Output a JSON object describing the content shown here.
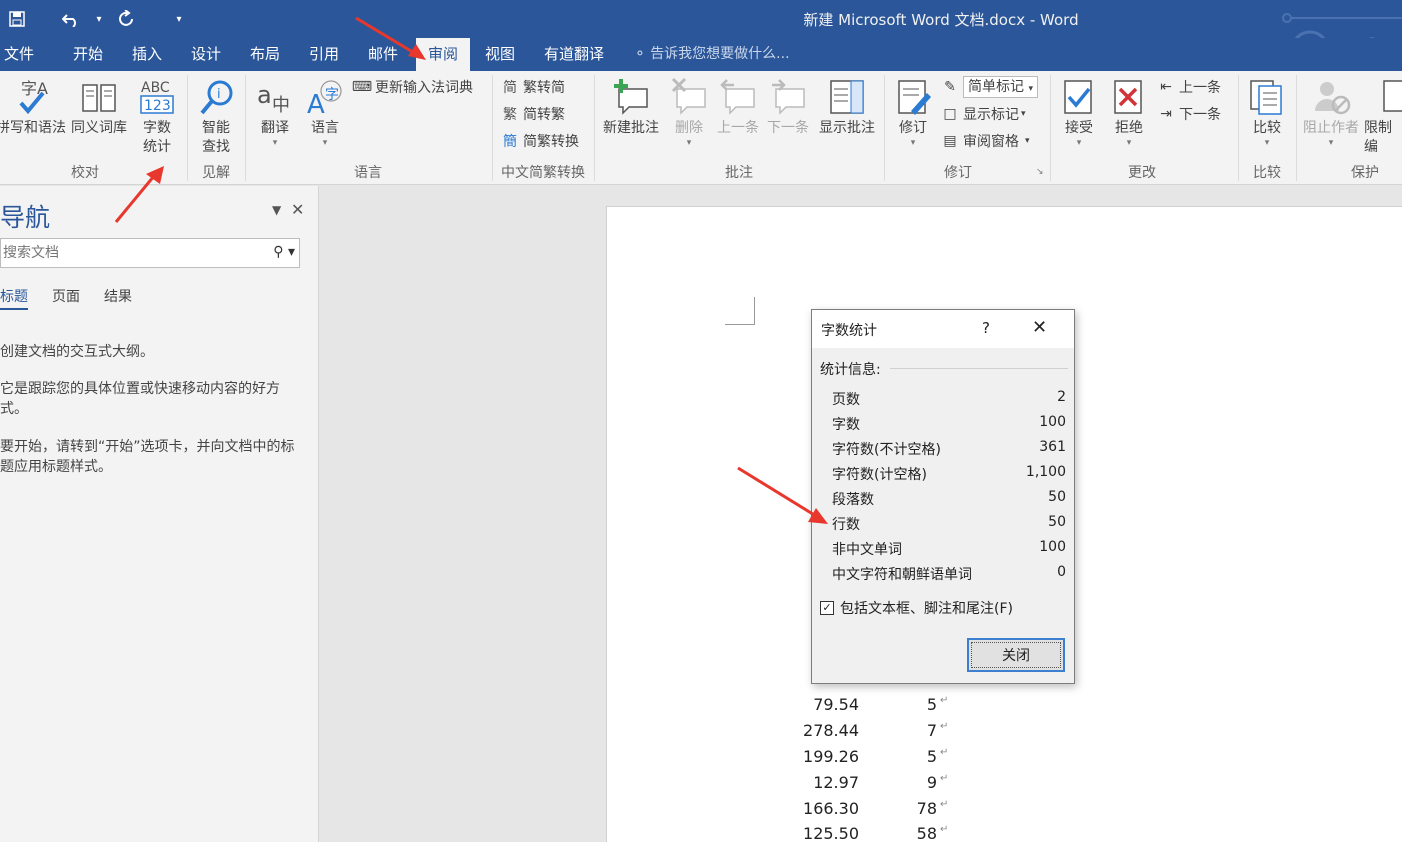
{
  "window": {
    "title": "新建 Microsoft Word 文档.docx - Word"
  },
  "qat": {
    "customize_glyph": "▾"
  },
  "tabs": [
    {
      "label": "文件"
    },
    {
      "label": "开始"
    },
    {
      "label": "插入"
    },
    {
      "label": "设计"
    },
    {
      "label": "布局"
    },
    {
      "label": "引用"
    },
    {
      "label": "邮件"
    },
    {
      "label": "审阅"
    },
    {
      "label": "视图"
    },
    {
      "label": "有道翻译"
    }
  ],
  "tell_me": "告诉我您想要做什么...",
  "ribbon": {
    "proofing": {
      "spelling": "拼写和语法",
      "thesaurus": "同义词库",
      "wordcount_line1": "字数",
      "wordcount_line2": "统计",
      "group": "校对"
    },
    "insights": {
      "smart_line1": "智能",
      "smart_line2": "查找",
      "group": "见解"
    },
    "language": {
      "translate": "翻译",
      "language": "语言",
      "update_ime": "更新输入法词典",
      "group": "语言"
    },
    "chinese": {
      "t2s": "繁转简",
      "s2t": "简转繁",
      "convert": "简繁转换",
      "group": "中文简繁转换"
    },
    "comments": {
      "new": "新建批注",
      "delete": "删除",
      "prev": "上一条",
      "next": "下一条",
      "show": "显示批注",
      "group": "批注"
    },
    "tracking": {
      "track": "修订",
      "simple_markup": "简单标记",
      "show_markup": "显示标记",
      "review_pane": "审阅窗格",
      "group": "修订"
    },
    "changes": {
      "accept": "接受",
      "reject": "拒绝",
      "prev": "上一条",
      "next": "下一条",
      "group": "更改"
    },
    "compare": {
      "compare": "比较",
      "group": "比较"
    },
    "protect": {
      "block_authors": "阻止作者",
      "restrict": "限制编",
      "group": "保护"
    }
  },
  "nav": {
    "title": "导航",
    "search_placeholder": "搜索文档",
    "tabs": [
      "标题",
      "页面",
      "结果"
    ],
    "text1": "创建文档的交互式大纲。",
    "text2": "它是跟踪您的具体位置或快速移动内容的好方式。",
    "text3": "要开始，请转到“开始”选项卡，并向文档中的标题应用标题样式。"
  },
  "doc_rows": [
    {
      "a": "79.54",
      "b": "5"
    },
    {
      "a": "278.44",
      "b": "7"
    },
    {
      "a": "199.26",
      "b": "5"
    },
    {
      "a": "12.97",
      "b": "9"
    },
    {
      "a": "166.30",
      "b": "78"
    },
    {
      "a": "125.50",
      "b": "58"
    }
  ],
  "dialog": {
    "title": "字数统计",
    "help": "?",
    "stats_label": "统计信息:",
    "stats": [
      {
        "label": "页数",
        "value": "2"
      },
      {
        "label": "字数",
        "value": "100"
      },
      {
        "label": "字符数(不计空格)",
        "value": "361"
      },
      {
        "label": "字符数(计空格)",
        "value": "1,100"
      },
      {
        "label": "段落数",
        "value": "50"
      },
      {
        "label": "行数",
        "value": "50"
      },
      {
        "label": "非中文单词",
        "value": "100"
      },
      {
        "label": "中文字符和朝鲜语单词",
        "value": "0"
      }
    ],
    "include_label": "包括文本框、脚注和尾注(F)",
    "include_checked": true,
    "close_label": "关闭"
  },
  "colors": {
    "accent": "#2b579a",
    "annotation_arrow": "#e8372c"
  }
}
